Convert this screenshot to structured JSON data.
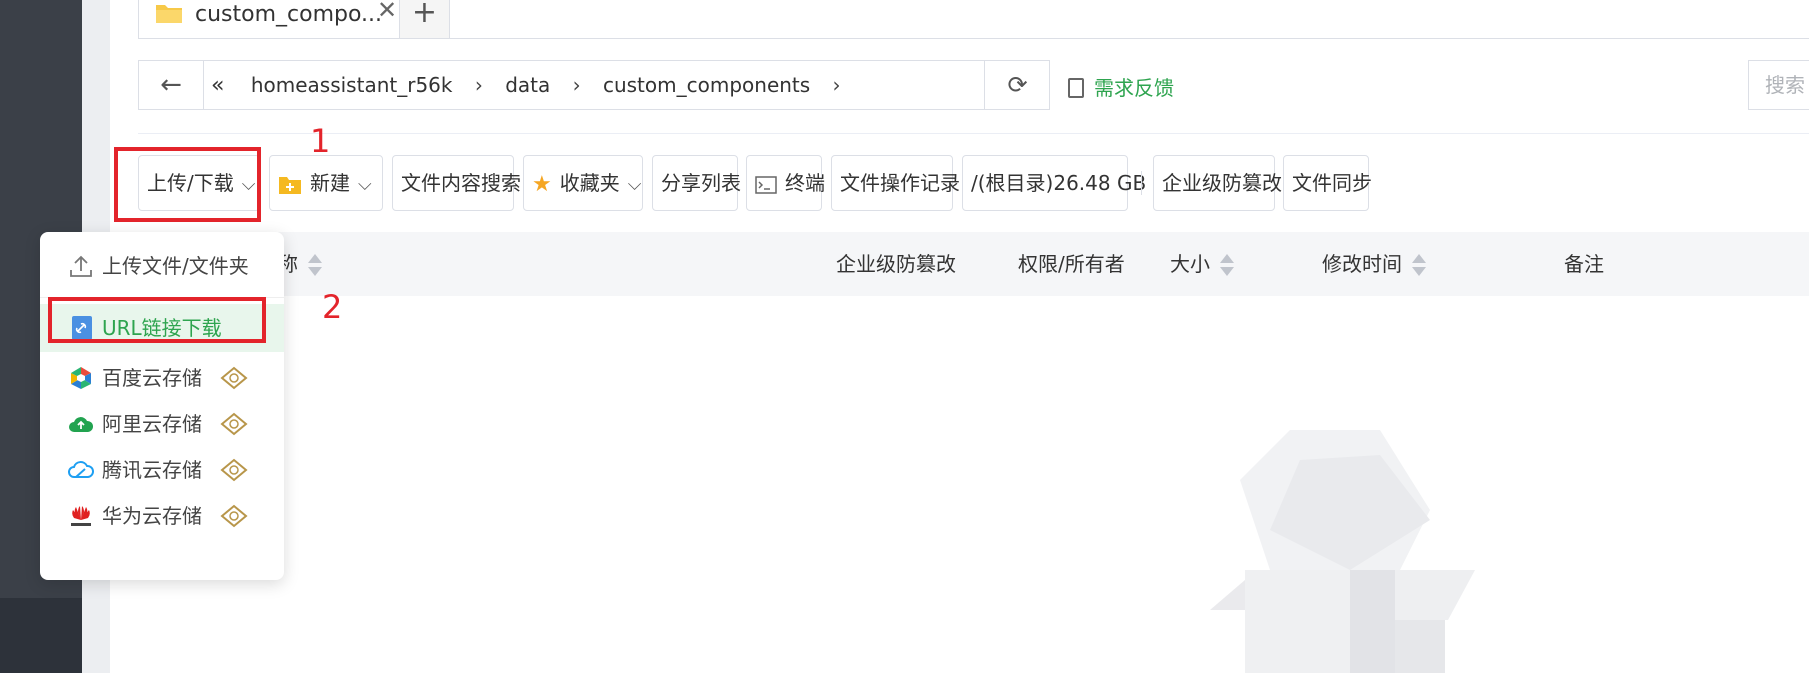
{
  "tabs": {
    "active_label": "custom_compo...",
    "close": "✕",
    "add": "+"
  },
  "address": {
    "back": "←",
    "collapse": "«",
    "crumbs": [
      "homeassistant_r56k",
      "data",
      "custom_components"
    ],
    "sep": "›",
    "refresh": "⟳"
  },
  "feedback": {
    "label": "需求反馈"
  },
  "search": {
    "placeholder": "搜索"
  },
  "toolbar": {
    "upload_download": "上传/下载",
    "new": "新建",
    "content_search": "文件内容搜索",
    "favorites": "收藏夹",
    "share_list": "分享列表",
    "terminal": "终端",
    "op_log": "文件操作记录",
    "disk": "/(根目录)26.48 GB",
    "tamper": "企业级防篡改",
    "sync": "文件同步",
    "chevron": "⌵"
  },
  "table_header": {
    "name": "名称",
    "tamper": "企业级防篡改",
    "perm": "权限/所有者",
    "size": "大小",
    "mtime": "修改时间",
    "note": "备注"
  },
  "dropdown": {
    "items": [
      {
        "label": "上传文件/文件夹",
        "icon": "upload-icon"
      },
      {
        "label": "URL链接下载",
        "icon": "url-link-icon"
      },
      {
        "label": "百度云存储",
        "icon": "baidu-cloud-icon"
      },
      {
        "label": "阿里云存储",
        "icon": "aliyun-icon"
      },
      {
        "label": "腾讯云存储",
        "icon": "tencent-cloud-icon"
      },
      {
        "label": "华为云存储",
        "icon": "huawei-cloud-icon"
      }
    ]
  },
  "annotations": {
    "n1": "1",
    "n2": "2"
  },
  "colors": {
    "accent_green": "#2ea44f",
    "annotation_red": "#e3242b"
  }
}
